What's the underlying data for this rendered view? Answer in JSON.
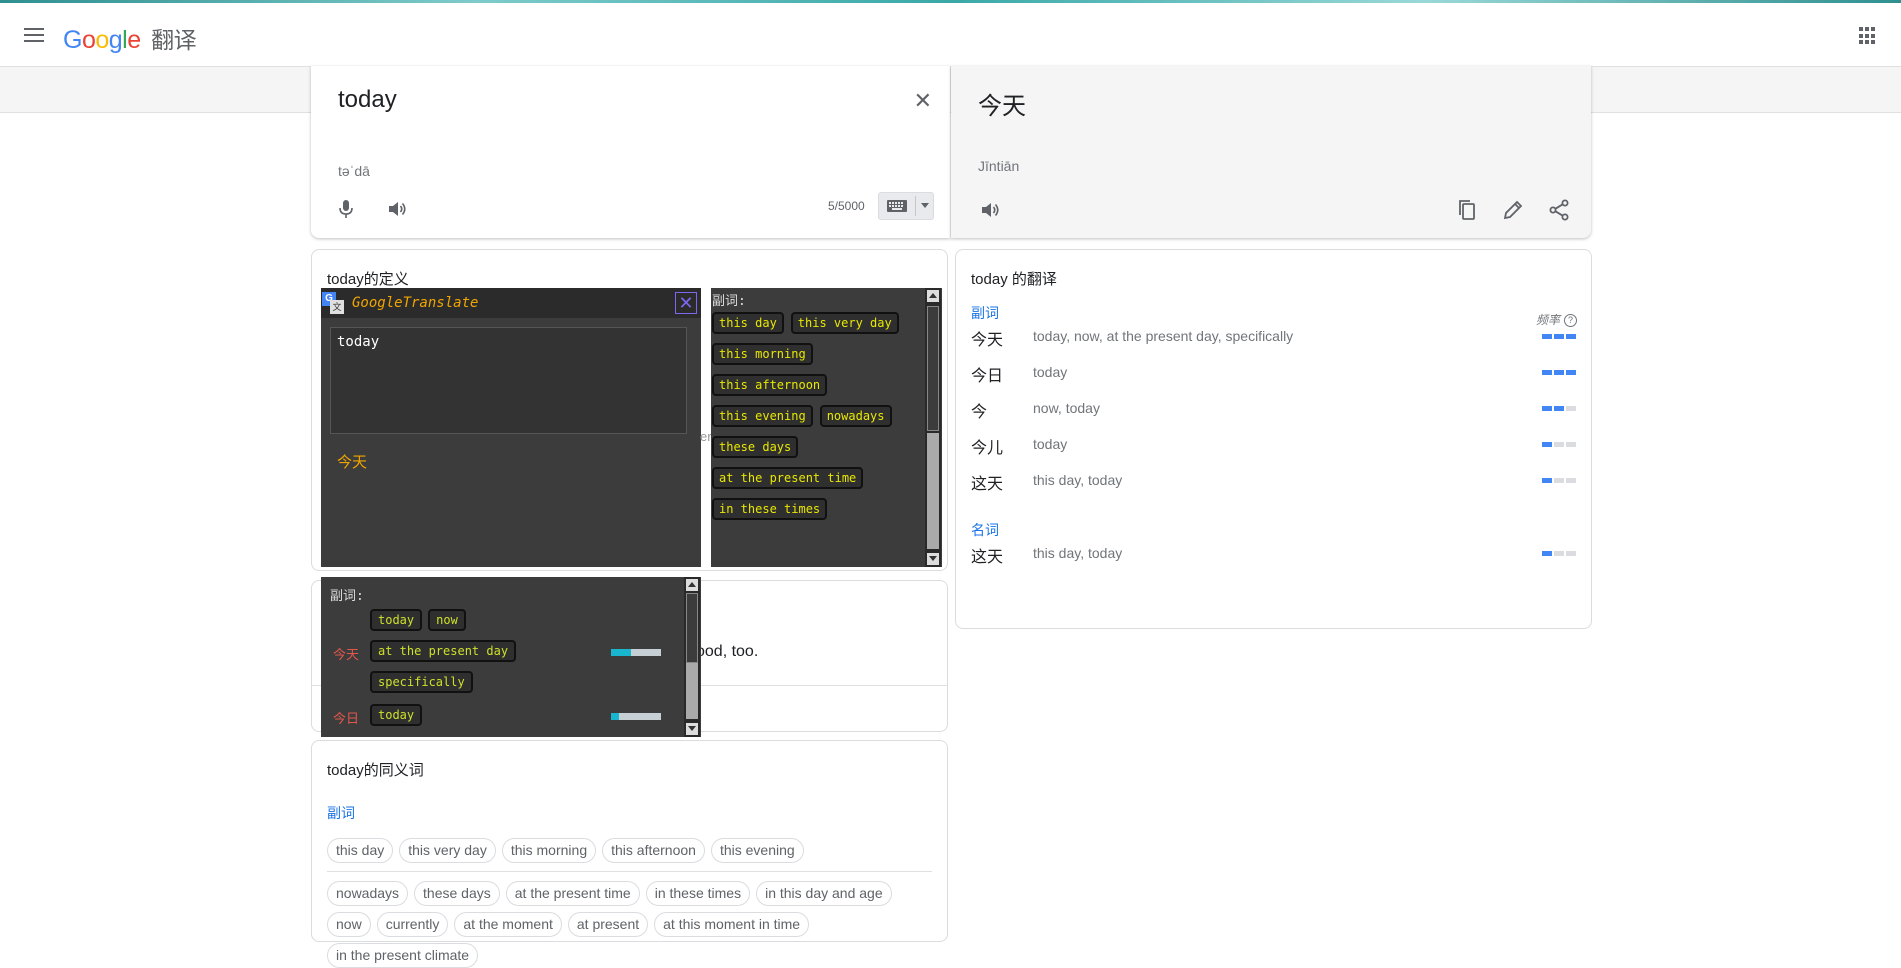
{
  "header": {
    "logo_google": "Google",
    "logo_product": "翻译"
  },
  "source": {
    "text": "today",
    "transliteration": "təˈdā",
    "char_count": "5/5000"
  },
  "target": {
    "text": "今天",
    "transliteration": "Jīntiān"
  },
  "definitions": {
    "title": "today的定义"
  },
  "examples": {
    "visible_text": "ood, too."
  },
  "synonyms": {
    "title": "today的同义词",
    "pos": "副词",
    "row1": [
      "this day",
      "this very day",
      "this morning",
      "this afternoon",
      "this evening"
    ],
    "row2": [
      "nowadays",
      "these days",
      "at the present time",
      "in these times",
      "in this day and age",
      "now",
      "currently",
      "at the moment",
      "at present",
      "at this moment in time",
      "in the present climate"
    ]
  },
  "translations": {
    "title": "today 的翻译",
    "freq_label": "频率",
    "help": "?",
    "groups": [
      {
        "pos": "副词",
        "rows": [
          {
            "word": "今天",
            "meaning": "today, now, at the present day, specifically",
            "freq": 3
          },
          {
            "word": "今日",
            "meaning": "today",
            "freq": 3
          },
          {
            "word": "今",
            "meaning": "now, today",
            "freq": 2
          },
          {
            "word": "今儿",
            "meaning": "today",
            "freq": 1
          },
          {
            "word": "这天",
            "meaning": "this day, today",
            "freq": 1
          }
        ]
      },
      {
        "pos": "名词",
        "rows": [
          {
            "word": "这天",
            "meaning": "this day, today",
            "freq": 1
          }
        ]
      }
    ]
  },
  "gt_popup": {
    "title": "GoogleTranslate",
    "logo_a": "G",
    "logo_b": "文",
    "close": "✕",
    "input": "today",
    "output": "今天"
  },
  "syn_popup": {
    "label": "副词:",
    "rows": [
      [
        "this day",
        "this very day"
      ],
      [
        "this morning"
      ],
      [
        "this afternoon"
      ],
      [
        "this evening",
        "nowadays"
      ],
      [
        "these days"
      ],
      [
        "at the present time"
      ],
      [
        "in these times"
      ]
    ]
  },
  "dict_popup": {
    "label": "副词:",
    "entries": [
      {
        "zh": "今天",
        "chips_rows": [
          [
            "today",
            "now"
          ],
          [
            "at the present day"
          ],
          [
            "specifically"
          ]
        ],
        "level": 0.4
      },
      {
        "zh": "今日",
        "chips_rows": [
          [
            "today"
          ]
        ],
        "level": 0.15
      }
    ]
  },
  "peek_text": "er"
}
